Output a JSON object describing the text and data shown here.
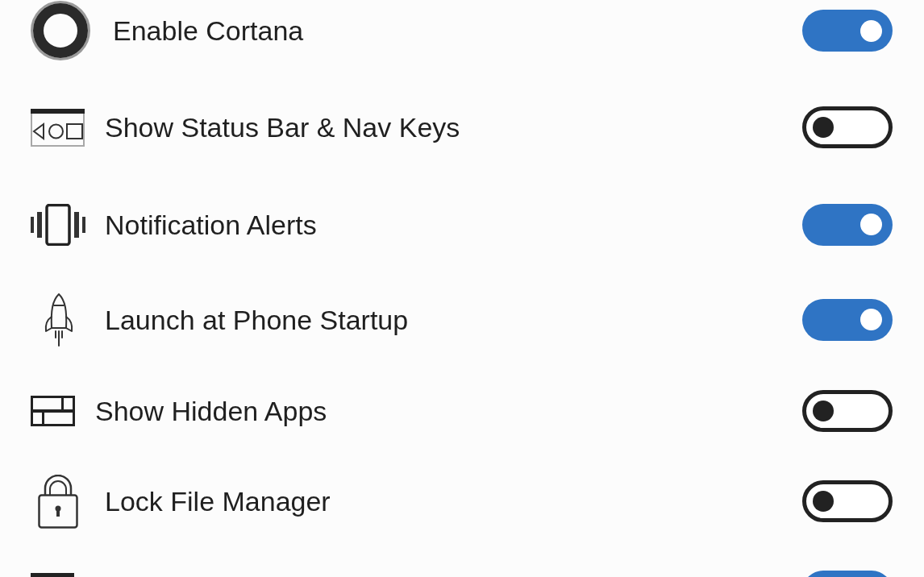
{
  "settings": [
    {
      "label": "Enable Cortana",
      "on": true
    },
    {
      "label": "Show Status Bar & Nav Keys",
      "on": false
    },
    {
      "label": "Notification Alerts",
      "on": true
    },
    {
      "label": "Launch at Phone Startup",
      "on": true
    },
    {
      "label": "Show Hidden Apps",
      "on": false
    },
    {
      "label": "Lock File Manager",
      "on": false
    },
    {
      "on": true
    }
  ]
}
